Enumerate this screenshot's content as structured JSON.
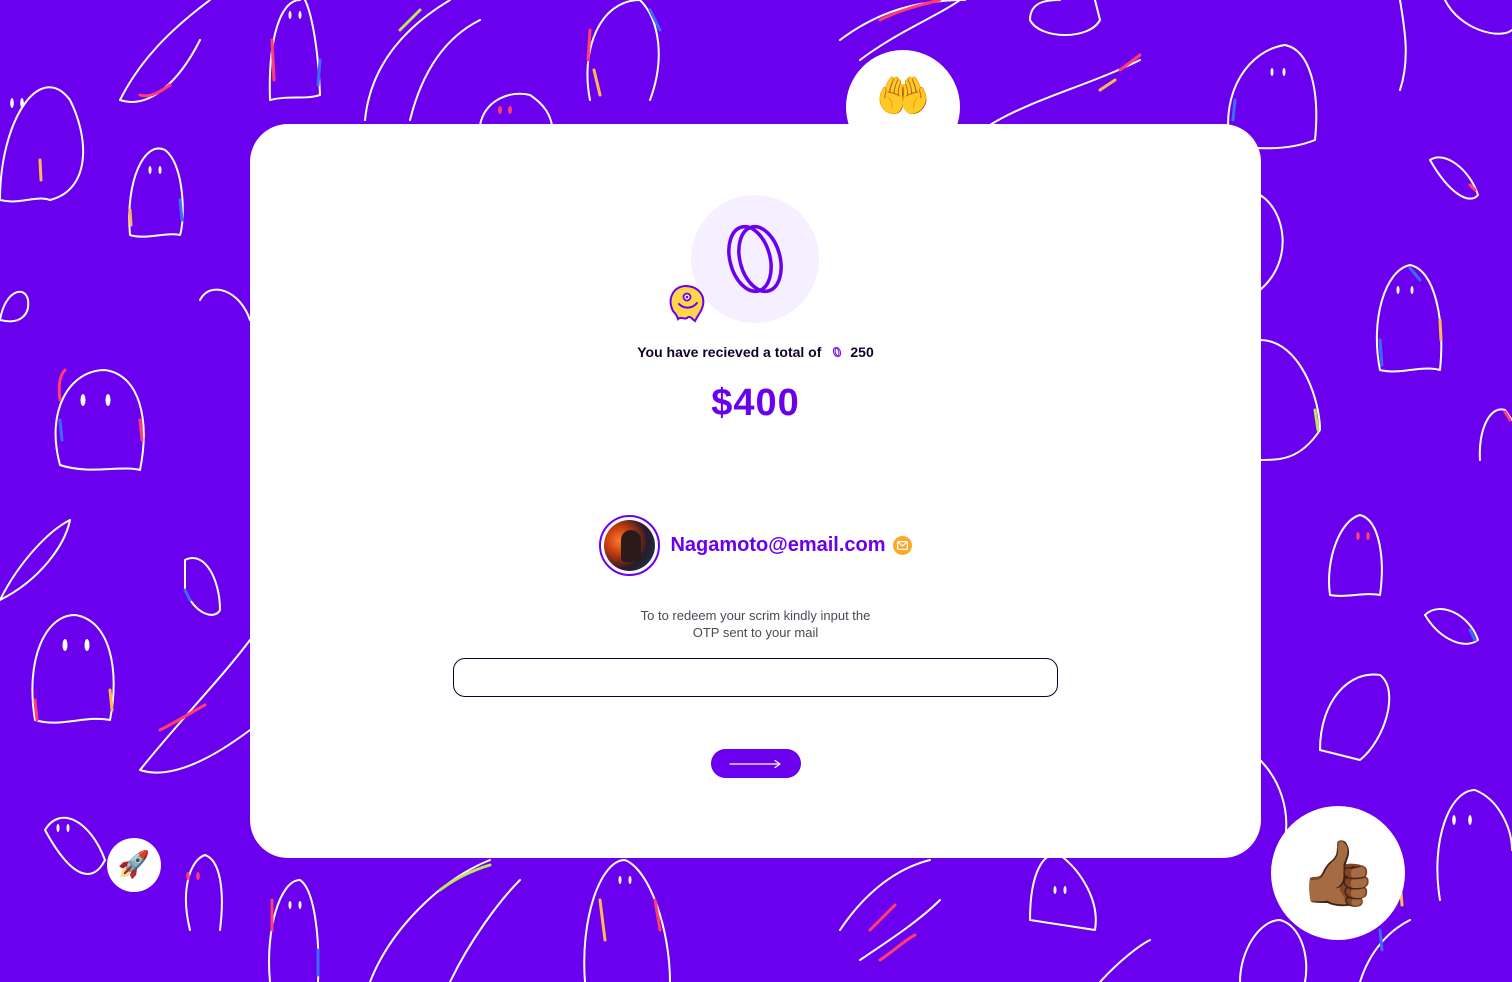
{
  "theme": {
    "background": "#6b00ee",
    "accent": "#6b00ee",
    "card": "#ffffff"
  },
  "decor": {
    "hands_emoji": "🤲",
    "rocket_emoji": "🚀",
    "thumbs_emoji": "👍🏾"
  },
  "card": {
    "logo_icon": "scrim-logo-icon",
    "mascot_icon": "ghost-mascot-icon",
    "total_label": "You have recieved a total of",
    "token_icon": "scrim-token-icon",
    "total_tokens": "250",
    "amount": "$400",
    "user": {
      "email": "Nagamoto@email.com",
      "avatar_icon": "user-avatar",
      "mail_icon": "envelope-icon"
    },
    "instruction": "To to redeem your scrim kindly input the\nOTP sent to your mail",
    "otp": {
      "value": "",
      "placeholder": ""
    },
    "submit_icon": "arrow-right-icon"
  }
}
